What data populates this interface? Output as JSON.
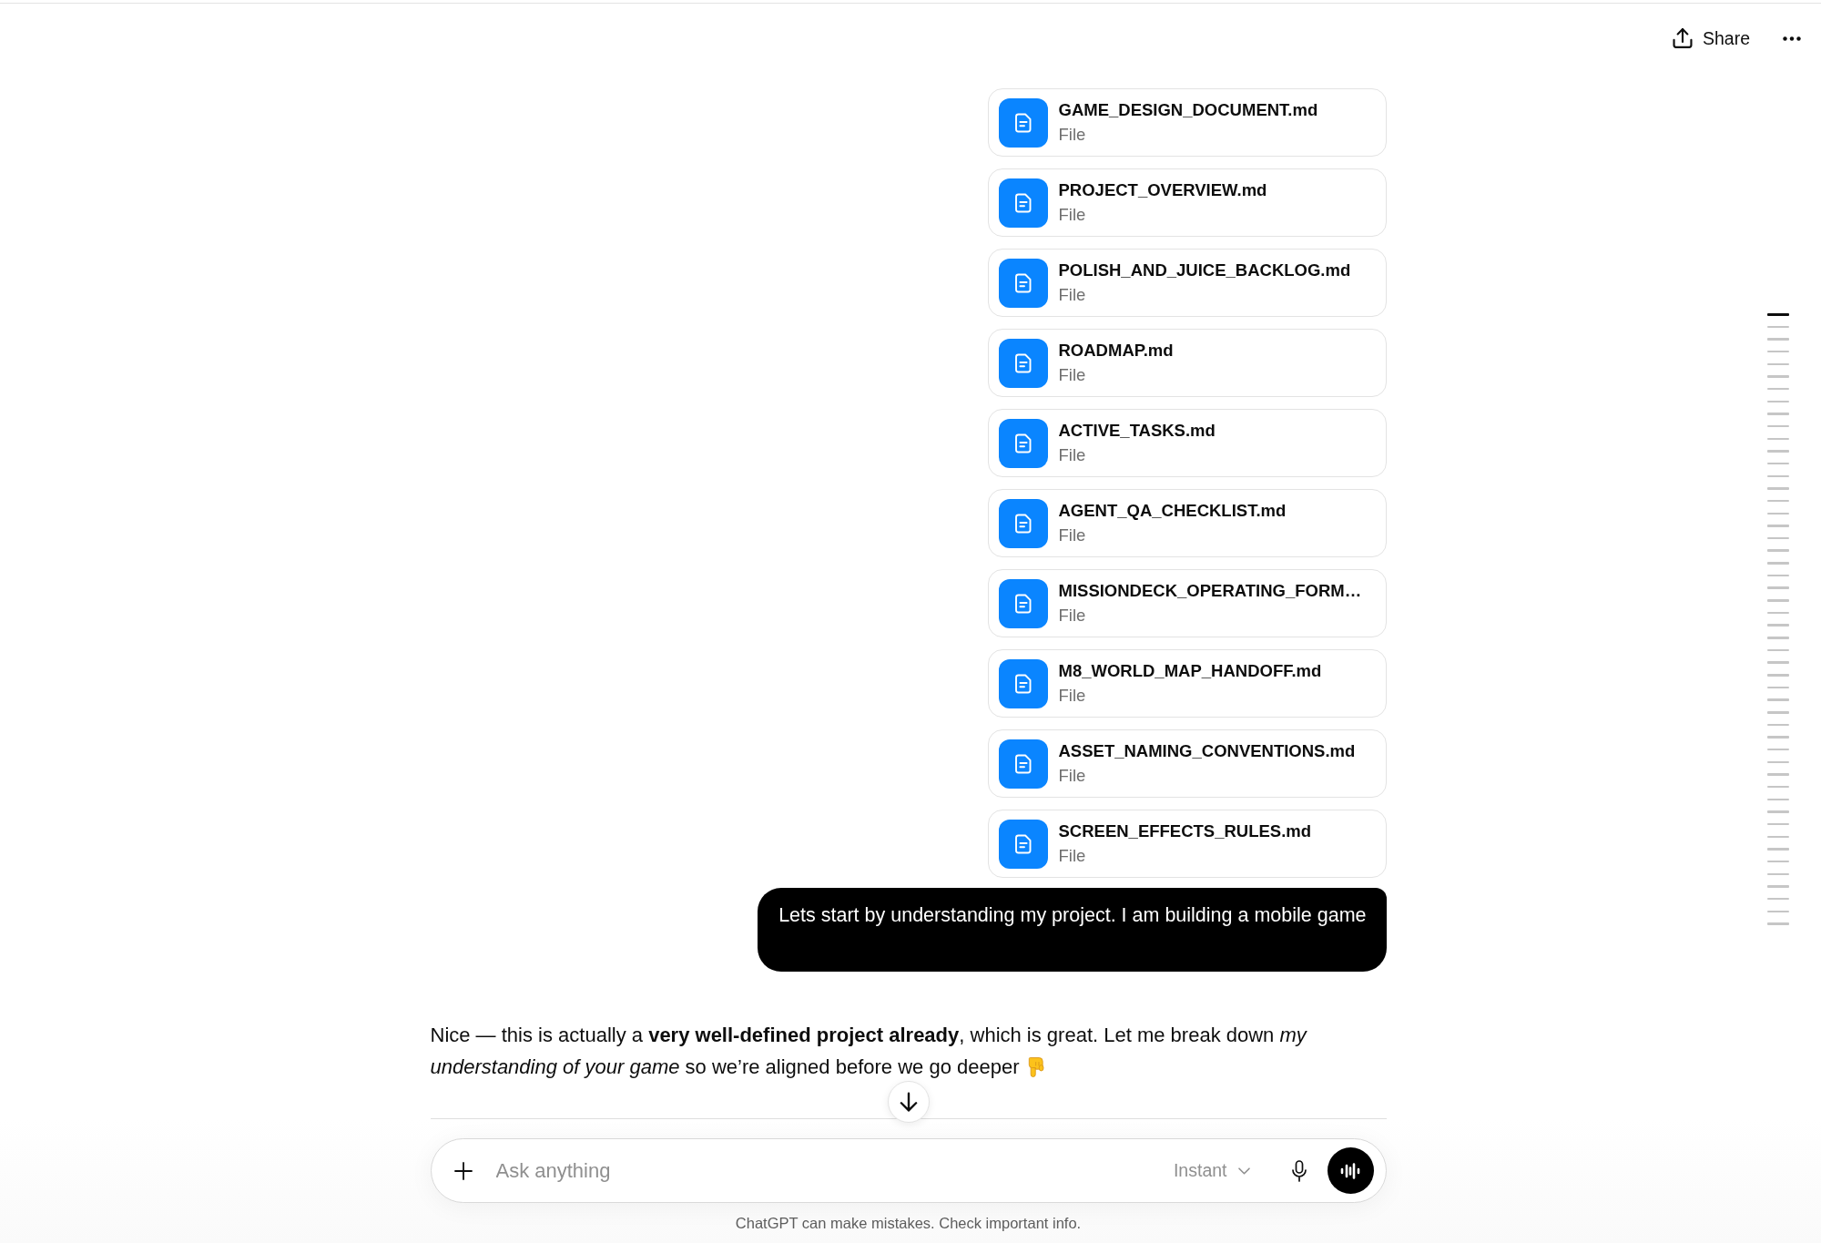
{
  "header": {
    "share_label": "Share"
  },
  "attachments": [
    {
      "name": "GAME_DESIGN_DOCUMENT.md",
      "subtitle": "File"
    },
    {
      "name": "PROJECT_OVERVIEW.md",
      "subtitle": "File"
    },
    {
      "name": "POLISH_AND_JUICE_BACKLOG.md",
      "subtitle": "File"
    },
    {
      "name": "ROADMAP.md",
      "subtitle": "File"
    },
    {
      "name": "ACTIVE_TASKS.md",
      "subtitle": "File"
    },
    {
      "name": "AGENT_QA_CHECKLIST.md",
      "subtitle": "File"
    },
    {
      "name": "MISSIONDECK_OPERATING_FORM…",
      "subtitle": "File"
    },
    {
      "name": "M8_WORLD_MAP_HANDOFF.md",
      "subtitle": "File"
    },
    {
      "name": "ASSET_NAMING_CONVENTIONS.md",
      "subtitle": "File"
    },
    {
      "name": "SCREEN_EFFECTS_RULES.md",
      "subtitle": "File"
    }
  ],
  "user_message": {
    "text": "Lets start by understanding my project. I am building a mobile game"
  },
  "assistant_message": {
    "text": "Nice — this is actually a **very well-defined project already**, which is great. Let me break down *my understanding of your game* so we’re aligned before we go deeper"
  },
  "composer": {
    "placeholder": "Ask anything",
    "model": "Instant"
  },
  "disclaimer": "ChatGPT can make mistakes. Check important info.",
  "scroll_markers": [
    {
      "selected": true
    },
    {
      "selected": false
    },
    {
      "selected": false
    },
    {
      "selected": false
    },
    {
      "selected": false
    },
    {
      "selected": false
    },
    {
      "selected": false
    },
    {
      "selected": false
    },
    {
      "selected": false
    },
    {
      "selected": false
    },
    {
      "selected": false
    },
    {
      "selected": false
    },
    {
      "selected": false
    },
    {
      "selected": false
    },
    {
      "selected": false
    },
    {
      "selected": false
    },
    {
      "selected": false
    },
    {
      "selected": false
    },
    {
      "selected": false
    },
    {
      "selected": false
    },
    {
      "selected": false
    },
    {
      "selected": false
    },
    {
      "selected": false
    },
    {
      "selected": false
    },
    {
      "selected": false
    },
    {
      "selected": false
    },
    {
      "selected": false
    },
    {
      "selected": false
    },
    {
      "selected": false
    },
    {
      "selected": false
    },
    {
      "selected": false
    },
    {
      "selected": false
    },
    {
      "selected": false
    },
    {
      "selected": false
    },
    {
      "selected": false
    },
    {
      "selected": false
    },
    {
      "selected": false
    },
    {
      "selected": false
    },
    {
      "selected": false
    },
    {
      "selected": false
    },
    {
      "selected": false
    },
    {
      "selected": false
    },
    {
      "selected": false
    },
    {
      "selected": false
    },
    {
      "selected": false
    },
    {
      "selected": false
    },
    {
      "selected": false
    },
    {
      "selected": false
    },
    {
      "selected": false
    },
    {
      "selected": false
    }
  ]
}
